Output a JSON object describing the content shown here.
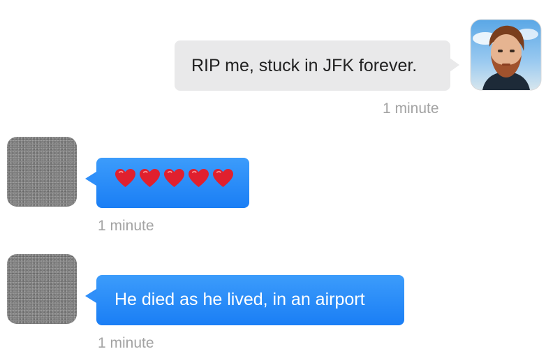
{
  "messages": [
    {
      "direction": "outgoing",
      "text": "RIP me, stuck in JFK forever.",
      "time": "1 minute",
      "avatar": "user-photo-avatar"
    },
    {
      "direction": "incoming",
      "text": "❤️❤️❤️❤️❤️",
      "emoji": "red-heart-icon",
      "emoji_count": 5,
      "time": "1 minute",
      "avatar": "blurred-avatar"
    },
    {
      "direction": "incoming",
      "text": "He died as he lived, in an airport",
      "time": "1 minute",
      "avatar": "blurred-avatar"
    }
  ],
  "colors": {
    "outgoing_bubble": "#e9e9ea",
    "incoming_bubble": "#1f84f7",
    "timestamp": "#a3a3a3",
    "heart": "#e0202e"
  }
}
